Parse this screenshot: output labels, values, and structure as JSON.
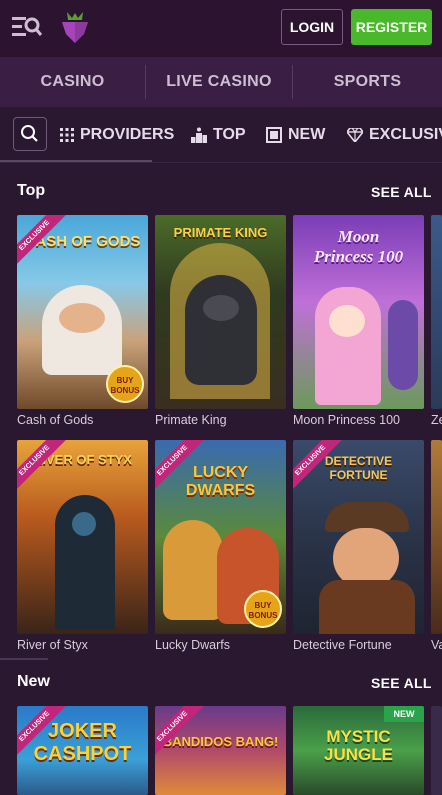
{
  "header": {
    "login_label": "LOGIN",
    "register_label": "REGISTER"
  },
  "main_nav": {
    "tabs": [
      {
        "label": "CASINO"
      },
      {
        "label": "LIVE CASINO"
      },
      {
        "label": "SPORTS"
      }
    ]
  },
  "sub_nav": {
    "items": [
      {
        "label": "PROVIDERS",
        "icon": "grid-icon"
      },
      {
        "label": "TOP",
        "icon": "podium-icon"
      },
      {
        "label": "NEW",
        "icon": "new-box-icon"
      },
      {
        "label": "EXCLUSIVE",
        "icon": "diamond-icon"
      }
    ]
  },
  "sections": {
    "top": {
      "title": "Top",
      "see_all": "SEE ALL",
      "games": [
        {
          "name": "Cash of Gods",
          "art_title": "CASH OF GODS",
          "badge": "EXCLUSIVE",
          "bonus": "BUY BONUS"
        },
        {
          "name": "Primate King",
          "art_title": "PRIMATE KING"
        },
        {
          "name": "Moon Princess 100",
          "art_title": "Moon Princess 100"
        },
        {
          "name": "Ze"
        },
        {
          "name": "River of Styx",
          "art_title": "RIVER OF STYX",
          "badge": "EXCLUSIVE"
        },
        {
          "name": "Lucky Dwarfs",
          "art_title": "LUCKY DWARFS",
          "badge": "EXCLUSIVE",
          "bonus": "BUY BONUS"
        },
        {
          "name": "Detective Fortune",
          "art_title": "DETECTIVE FORTUNE",
          "badge": "EXCLUSIVE"
        },
        {
          "name": "Va"
        }
      ]
    },
    "new": {
      "title": "New",
      "see_all": "SEE ALL",
      "games": [
        {
          "art_title": "JOKER CASHPOT",
          "badge": "EXCLUSIVE"
        },
        {
          "art_title": "BANDIDOS BANG!",
          "badge": "EXCLUSIVE"
        },
        {
          "art_title": "MYSTIC JUNGLE",
          "new_badge": "NEW"
        }
      ]
    }
  },
  "colors": {
    "background": "#2a1730",
    "header": "#2c1431",
    "nav": "#3b1e44",
    "register": "#49b82a",
    "exclusive_ribbon": "#c2267a",
    "new_badge": "#2aa44a"
  }
}
